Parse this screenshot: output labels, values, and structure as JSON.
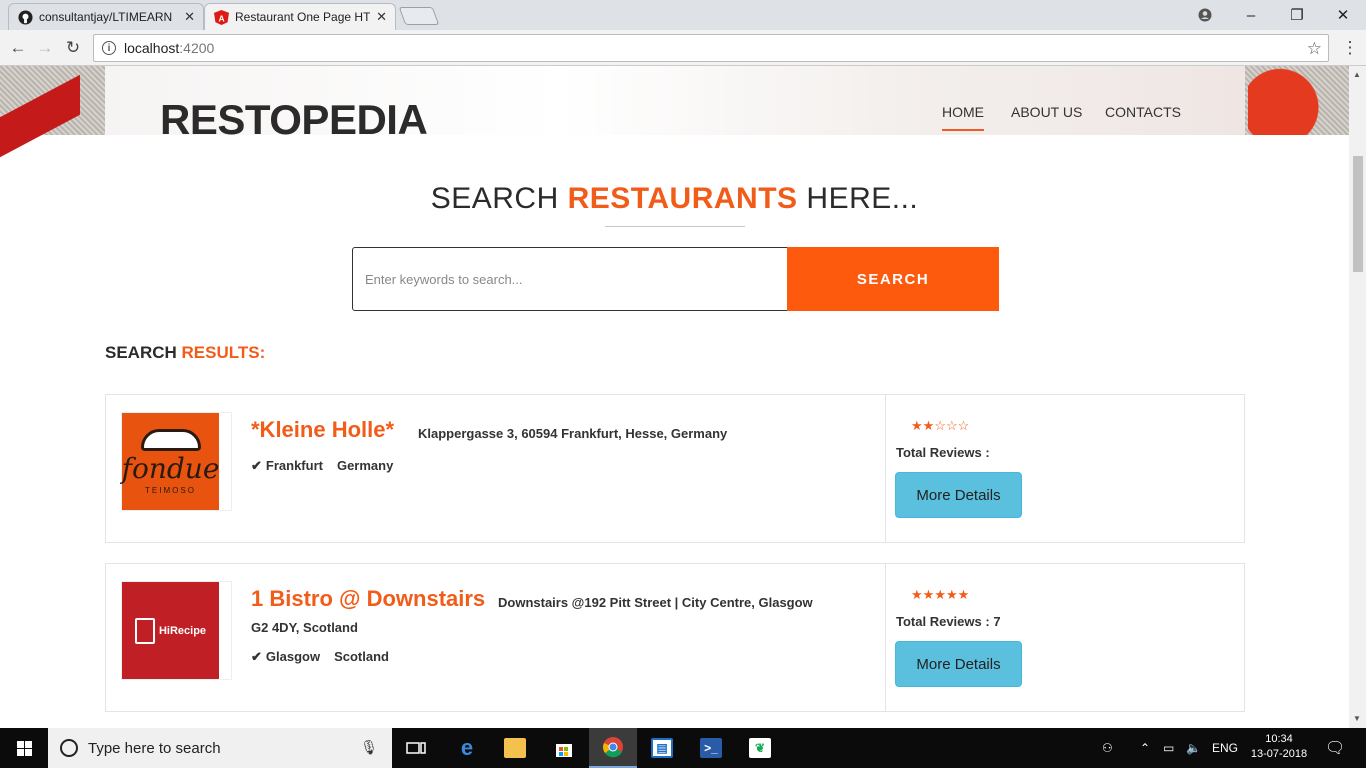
{
  "browser": {
    "tabs": [
      {
        "title": "consultantjay/LTIMEARN",
        "icon": "github-icon"
      },
      {
        "title": "Restaurant One Page HTM",
        "icon": "angular-icon"
      }
    ],
    "url_host": "localhost",
    "url_port": ":4200"
  },
  "site": {
    "brand": "RESTOPEDIA",
    "nav": [
      "HOME",
      "ABOUT US",
      "CONTACTS"
    ],
    "active_nav": "HOME"
  },
  "search": {
    "title_pre": "SEARCH",
    "title_highlight": "RESTAURANTS",
    "title_post": "HERE...",
    "placeholder": "Enter keywords to search...",
    "button_label": "SEARCH"
  },
  "results": {
    "heading_pre": "SEARCH",
    "heading_highlight": "RESULTS:",
    "items": [
      {
        "name": "*Kleine Holle*",
        "address": "Klappergasse 3, 60594 Frankfurt, Hesse, Germany",
        "address_line2": "",
        "city": "Frankfurt",
        "country": "Germany",
        "rating": 2,
        "rating_max": 5,
        "total_reviews_label": "Total Reviews :",
        "total_reviews": "",
        "button_label": "More Details",
        "logo": {
          "brand": "fondue",
          "sub": "TEIMOSO",
          "icon": "chef-hat-icon"
        }
      },
      {
        "name": "1 Bistro @ Downstairs",
        "address": "Downstairs @192 Pitt Street | City Centre, Glasgow",
        "address_line2": "G2 4DY, Scotland",
        "city": "Glasgow",
        "country": "Scotland",
        "rating": 5,
        "rating_max": 5,
        "total_reviews_label": "Total Reviews :",
        "total_reviews": "7",
        "button_label": "More Details",
        "logo": {
          "brand": "HiRecipe",
          "icon": "recipe-book-icon"
        }
      }
    ]
  },
  "taskbar": {
    "search_placeholder": "Type here to search",
    "language": "ENG",
    "time": "10:34",
    "date": "13-07-2018"
  },
  "colors": {
    "accent": "#f25c19",
    "search_button": "#fe5a0d",
    "details_button": "#5bc0de"
  }
}
